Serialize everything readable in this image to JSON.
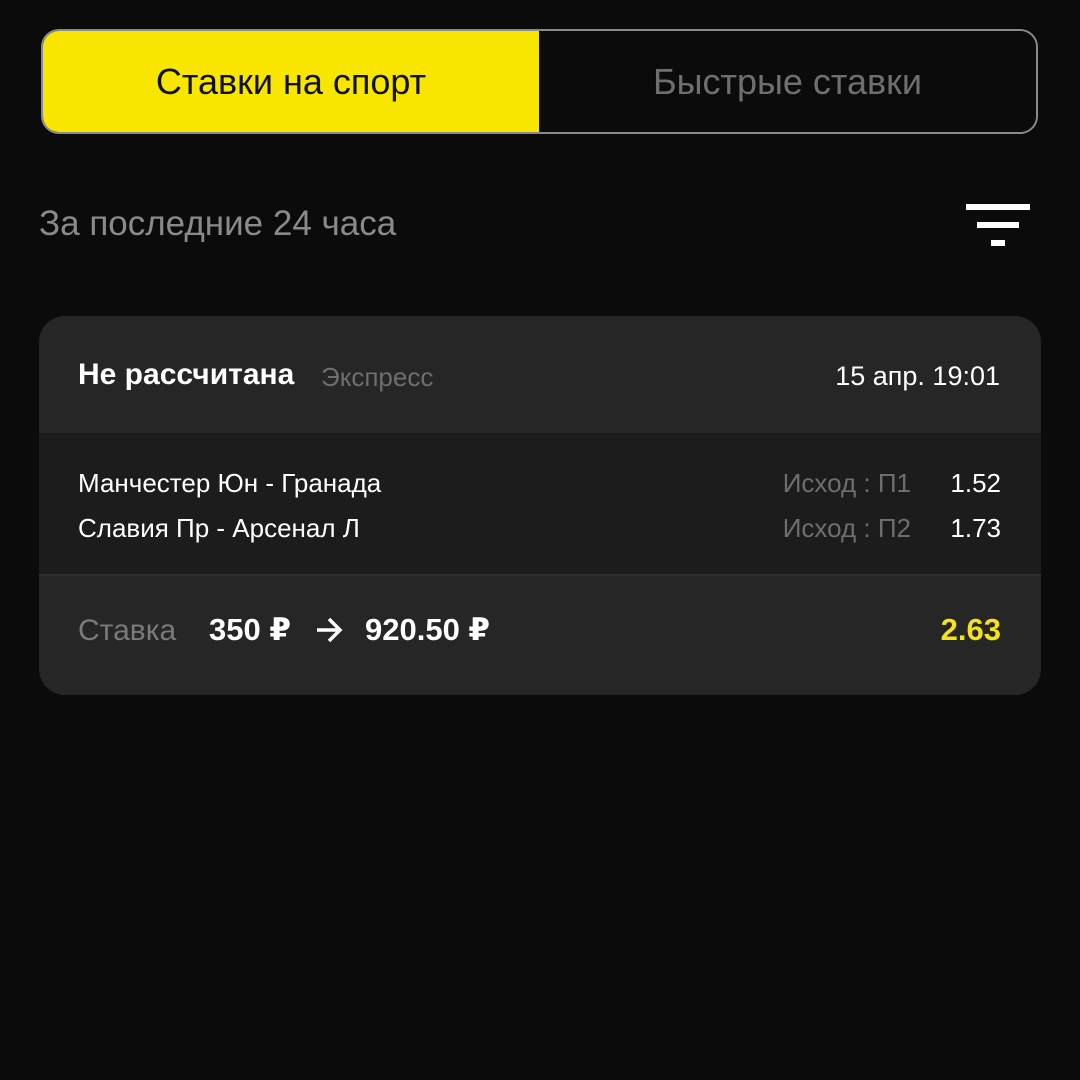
{
  "tabs": [
    {
      "label": "Ставки на спорт",
      "active": true
    },
    {
      "label": "Быстрые ставки",
      "active": false
    }
  ],
  "period": {
    "label": "За последние 24 часа",
    "filter_icon": "filter-icon"
  },
  "bet": {
    "status": "Не рассчитана",
    "type": "Экспресс",
    "date": "15 апр. 19:01",
    "events": [
      {
        "name": "Манчестер Юн - Гранада",
        "outcome": "Исход : П1",
        "odds": "1.52"
      },
      {
        "name": "Славия Пр - Арсенал Л",
        "outcome": "Исход : П2",
        "odds": "1.73"
      }
    ],
    "stake_label": "Ставка",
    "stake_amount": "350 ₽",
    "arrow_icon": "arrow-right-icon",
    "payout_amount": "920.50 ₽",
    "total_odds": "2.63"
  },
  "colors": {
    "accent": "#f8e600",
    "odds_highlight": "#f4e21a",
    "background": "#0b0b0b",
    "card": "#1c1c1c"
  }
}
